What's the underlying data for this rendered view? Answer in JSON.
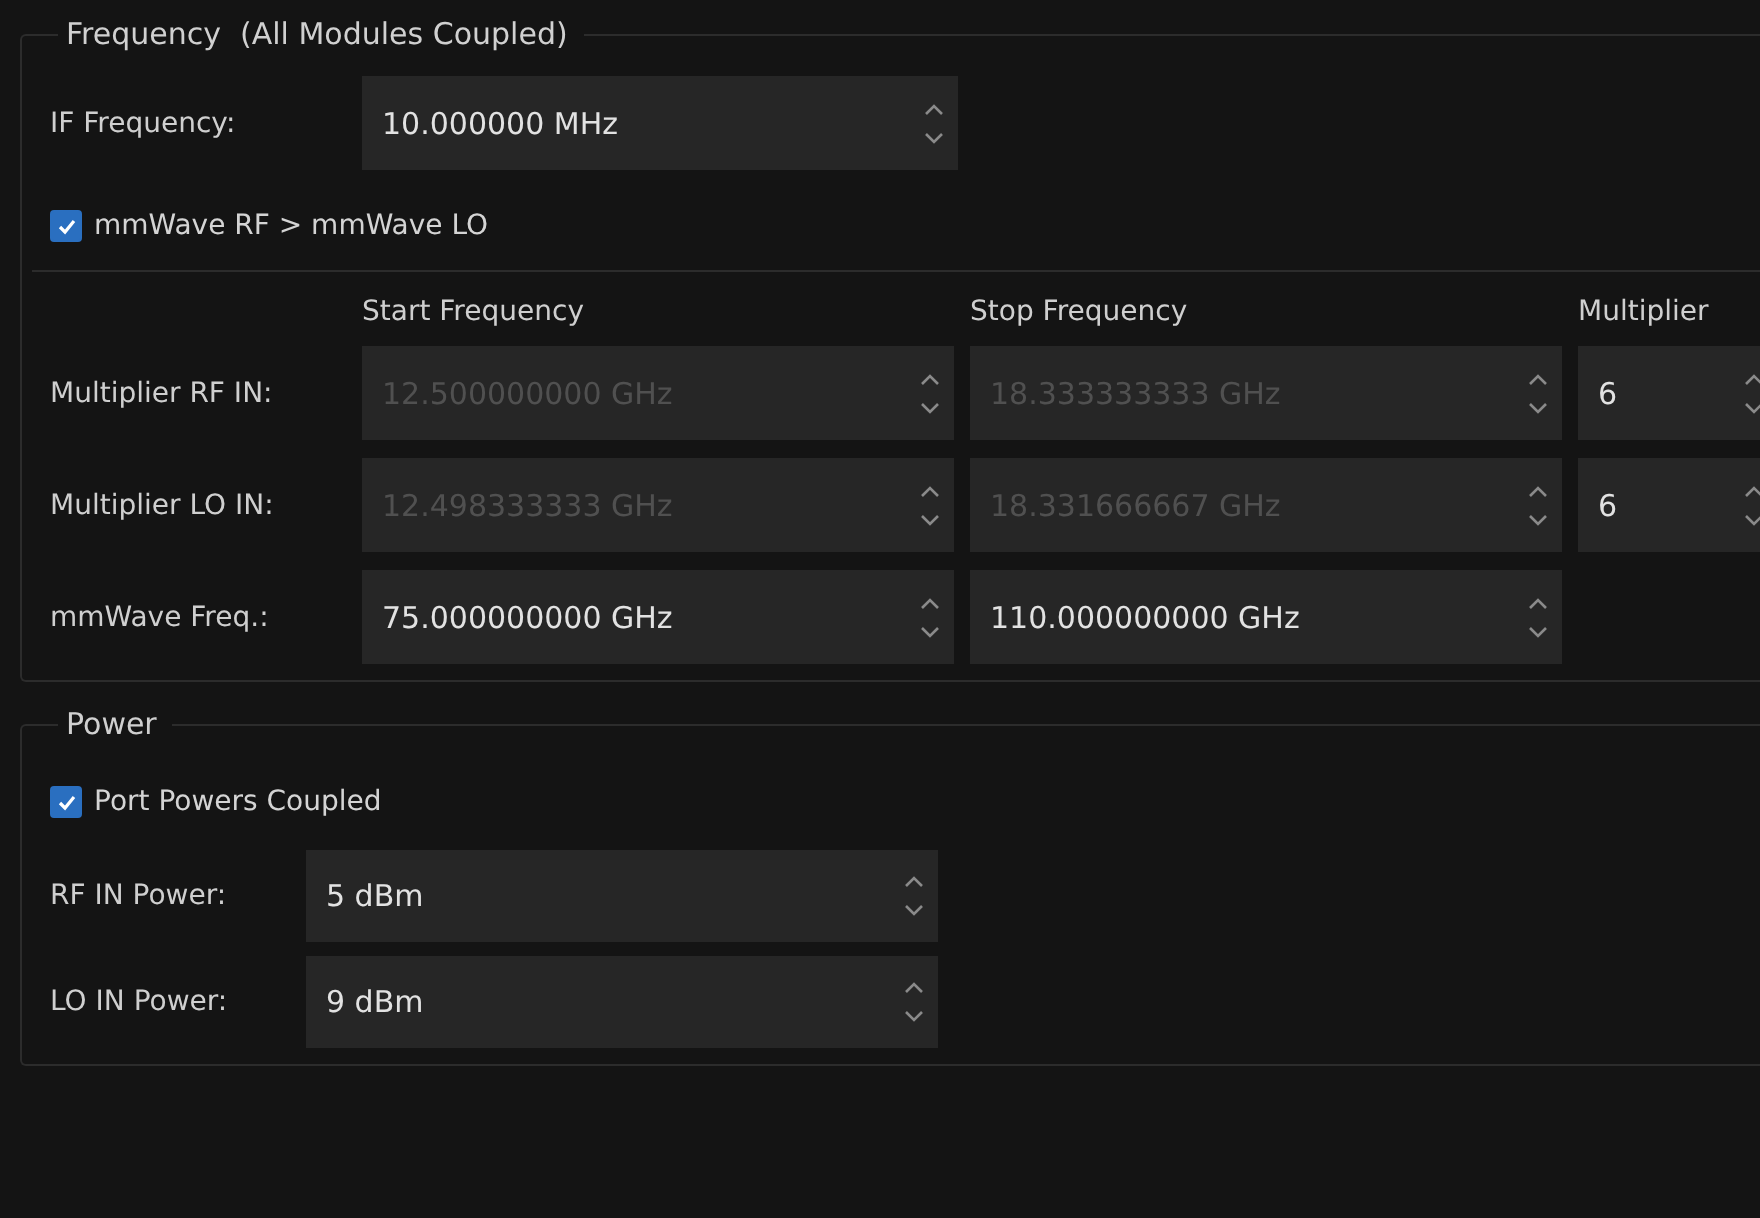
{
  "frequency_group": {
    "title": "Frequency  (All Modules Coupled)",
    "if_frequency": {
      "label": "IF Frequency:",
      "value": "10.000000 MHz",
      "disabled": false
    },
    "rf_above_lo": {
      "label": "mmWave RF > mmWave LO",
      "checked": true
    },
    "columns": [
      "Start Frequency",
      "Stop Frequency",
      "Multiplier"
    ],
    "rows": [
      {
        "label": "Multiplier RF IN:",
        "cells": [
          {
            "value": "12.500000000 GHz",
            "disabled": true
          },
          {
            "value": "18.333333333 GHz",
            "disabled": true
          },
          {
            "value": "6",
            "disabled": false
          }
        ]
      },
      {
        "label": "Multiplier LO IN:",
        "cells": [
          {
            "value": "12.498333333 GHz",
            "disabled": true
          },
          {
            "value": "18.331666667 GHz",
            "disabled": true
          },
          {
            "value": "6",
            "disabled": false
          }
        ]
      },
      {
        "label": "mmWave Freq.:",
        "cells": [
          {
            "value": "75.000000000 GHz",
            "disabled": false
          },
          {
            "value": "110.000000000 GHz",
            "disabled": false
          }
        ]
      }
    ]
  },
  "power_group": {
    "title": "Power",
    "port_powers_coupled": {
      "label": "Port Powers Coupled",
      "checked": true
    },
    "fields": [
      {
        "label": "RF IN Power:",
        "value": "5 dBm",
        "disabled": false
      },
      {
        "label": "LO IN Power:",
        "value": "9 dBm",
        "disabled": false
      }
    ]
  }
}
